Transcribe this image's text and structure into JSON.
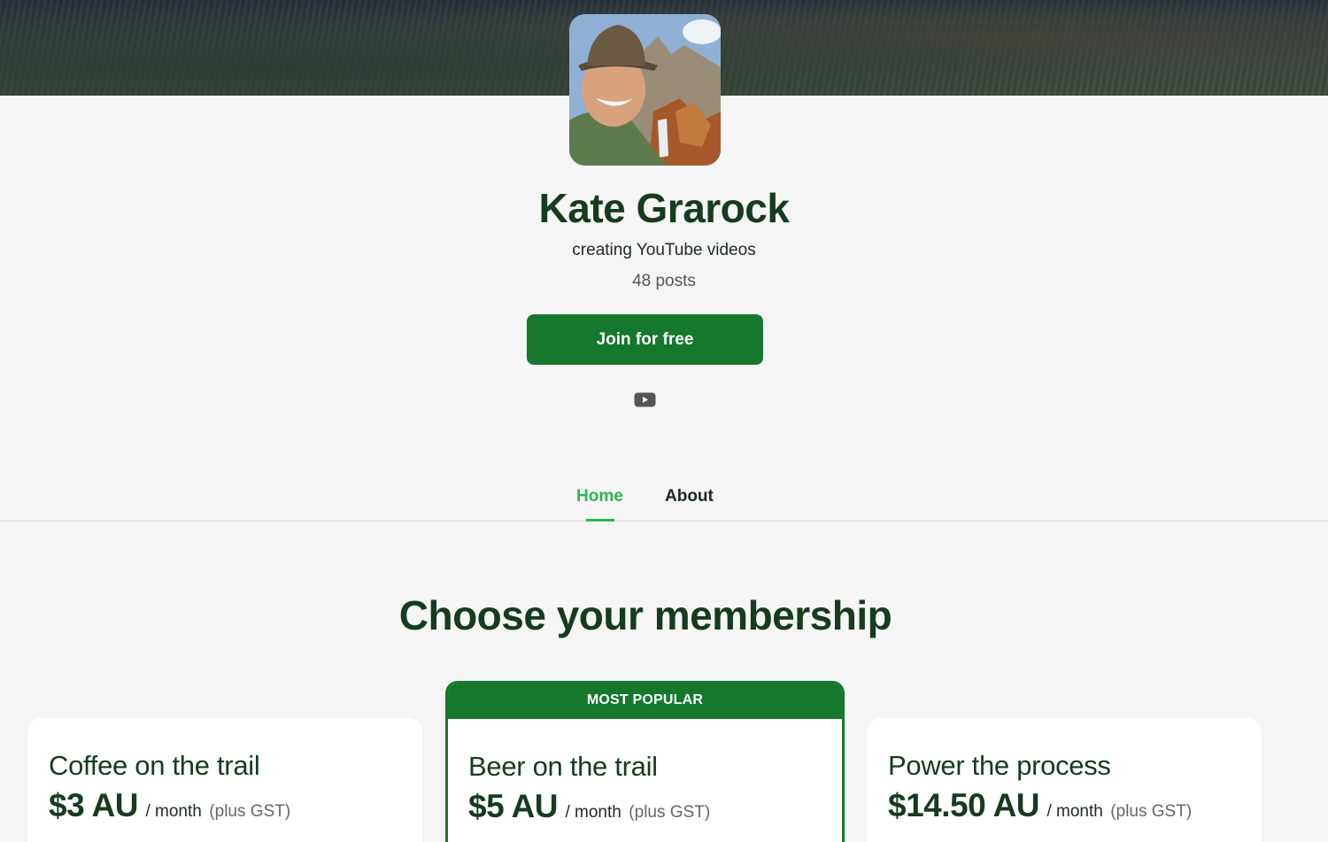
{
  "creator": {
    "name": "Kate Grarock",
    "tagline": "creating YouTube videos",
    "post_count": "48 posts",
    "join_label": "Join for free",
    "social_icon": "youtube-icon"
  },
  "tabs": [
    {
      "label": "Home",
      "active": true
    },
    {
      "label": "About",
      "active": false
    }
  ],
  "membership": {
    "title": "Choose your membership",
    "tiers": [
      {
        "name": "Coffee on the trail",
        "price": "$3 AU",
        "period": "/ month",
        "tax": "(plus GST)",
        "featured": false
      },
      {
        "name": "Beer on the trail",
        "price": "$5 AU",
        "period": "/ month",
        "tax": "(plus GST)",
        "featured": true,
        "badge": "MOST POPULAR"
      },
      {
        "name": "Power the process",
        "price": "$14.50 AU",
        "period": "/ month",
        "tax": "(plus GST)",
        "featured": false
      }
    ]
  },
  "colors": {
    "brand_green": "#15782c",
    "tab_active": "#2fb34f",
    "heading": "#163b1f",
    "background": "#f5f5f5"
  }
}
